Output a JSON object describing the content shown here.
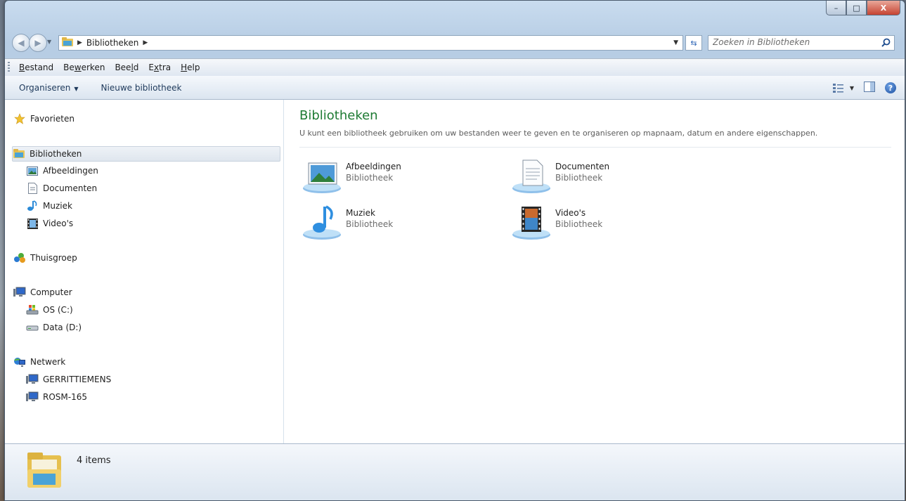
{
  "window": {
    "caption": {
      "minimize": "–",
      "maximize": "□",
      "close": "X"
    }
  },
  "address": {
    "crumbs": [
      "Bibliotheken"
    ],
    "search_placeholder": "Zoeken in Bibliotheken"
  },
  "menu": {
    "items": [
      {
        "label": "Bestand",
        "key": "B"
      },
      {
        "label": "Bewerken",
        "key": "w"
      },
      {
        "label": "Beeld",
        "key": "l"
      },
      {
        "label": "Extra",
        "key": "x"
      },
      {
        "label": "Help",
        "key": "H"
      }
    ]
  },
  "commands": {
    "organize": "Organiseren",
    "new_library": "Nieuwe bibliotheek",
    "help": "?"
  },
  "nav": {
    "favorites": "Favorieten",
    "libraries": "Bibliotheken",
    "library_items": [
      "Afbeeldingen",
      "Documenten",
      "Muziek",
      "Video's"
    ],
    "homegroup": "Thuisgroep",
    "computer": "Computer",
    "drives": [
      "OS (C:)",
      "Data (D:)"
    ],
    "network": "Netwerk",
    "network_items": [
      "GERRITTIEMENS",
      "ROSM-165"
    ]
  },
  "content": {
    "title": "Bibliotheken",
    "description": "U kunt een bibliotheek gebruiken om uw bestanden weer te geven en te organiseren op mapnaam, datum en andere eigenschappen.",
    "libraries": [
      {
        "name": "Afbeeldingen",
        "type": "Bibliotheek",
        "icon": "pictures-library-icon"
      },
      {
        "name": "Documenten",
        "type": "Bibliotheek",
        "icon": "documents-library-icon"
      },
      {
        "name": "Muziek",
        "type": "Bibliotheek",
        "icon": "music-library-icon"
      },
      {
        "name": "Video's",
        "type": "Bibliotheek",
        "icon": "videos-library-icon"
      }
    ]
  },
  "details": {
    "count": "4 items"
  }
}
